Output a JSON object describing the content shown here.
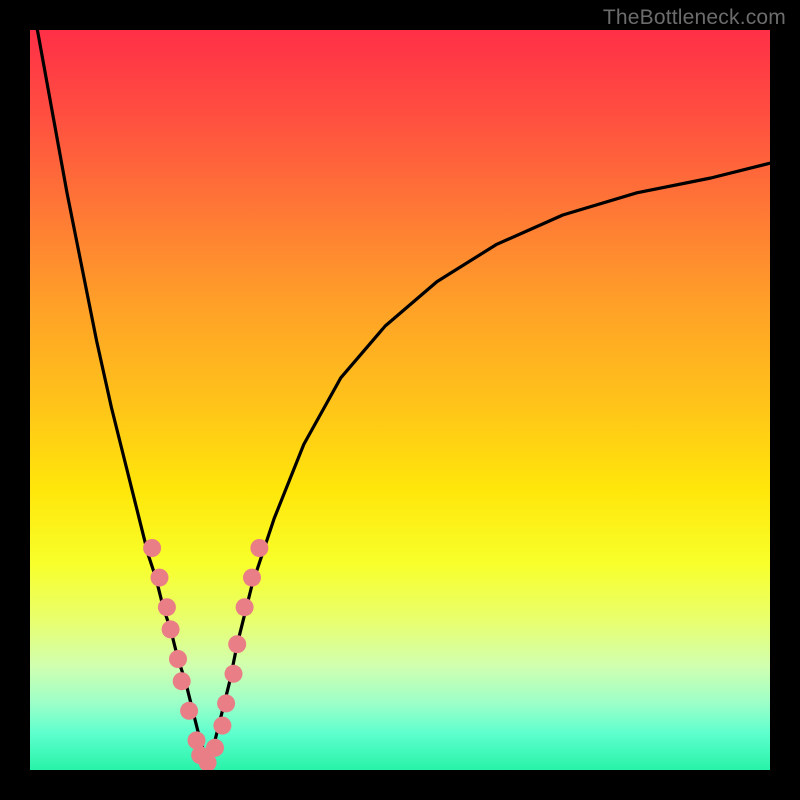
{
  "watermark": "TheBottleneck.com",
  "colors": {
    "marker": "#e97e86",
    "curve": "#000000"
  },
  "chart_data": {
    "type": "line",
    "title": "",
    "xlabel": "",
    "ylabel": "",
    "xlim": [
      0,
      100
    ],
    "ylim": [
      0,
      100
    ],
    "grid": false,
    "legend": false,
    "series": [
      {
        "name": "left-branch",
        "x": [
          1,
          3,
          5,
          7,
          9,
          11,
          13,
          14,
          15,
          16,
          17,
          18,
          19,
          20,
          21,
          22,
          23,
          24
        ],
        "y": [
          100,
          89,
          78,
          68,
          58,
          49,
          41,
          37,
          33,
          29,
          26,
          22,
          19,
          15,
          12,
          8,
          4,
          1
        ]
      },
      {
        "name": "right-branch",
        "x": [
          24,
          25,
          26,
          27,
          28,
          30,
          33,
          37,
          42,
          48,
          55,
          63,
          72,
          82,
          92,
          100
        ],
        "y": [
          1,
          4,
          8,
          12,
          17,
          25,
          34,
          44,
          53,
          60,
          66,
          71,
          75,
          78,
          80,
          82
        ]
      }
    ],
    "markers": {
      "name": "highlight-points",
      "x": [
        16.5,
        17.5,
        18.5,
        19,
        20,
        20.5,
        21.5,
        22.5,
        23,
        24,
        25,
        26,
        26.5,
        27.5,
        28,
        29,
        30,
        31
      ],
      "y": [
        30,
        26,
        22,
        19,
        15,
        12,
        8,
        4,
        2,
        1,
        3,
        6,
        9,
        13,
        17,
        22,
        26,
        30
      ]
    }
  }
}
